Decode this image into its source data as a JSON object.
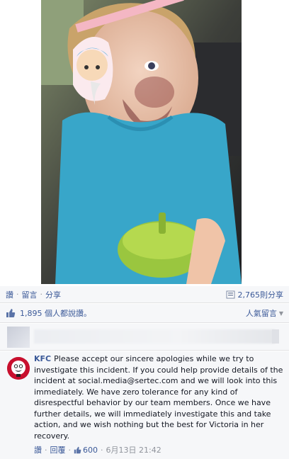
{
  "post": {
    "actions": {
      "like": "讚",
      "comment": "留言",
      "share": "分享",
      "share_count": "2,765則分享"
    },
    "likes": {
      "text": "1,895 個人都說讚。",
      "sort_label": "人氣留言"
    }
  },
  "comment": {
    "author": "KFC",
    "text": "Please accept our sincere apologies while we try to investigate this incident. If you could help provide details of the incident at social.media@sertec.com and we will look into this immediately. We have zero tolerance for any kind of disrespectful behavior by our team members. Once we have further details, we will immediately investigate this and take action, and we wish nothing but the best for Victoria in her recovery.",
    "like": "讚",
    "reply": "回覆",
    "like_count": "600",
    "timestamp": "6月13日 21:42"
  },
  "colors": {
    "link": "#3b5998",
    "bar_bg": "#f6f7f9",
    "kfc_red": "#c8102e"
  },
  "icons": [
    "share-icon",
    "thumbs-up-icon",
    "sort-caret-icon",
    "kfc-logo"
  ]
}
